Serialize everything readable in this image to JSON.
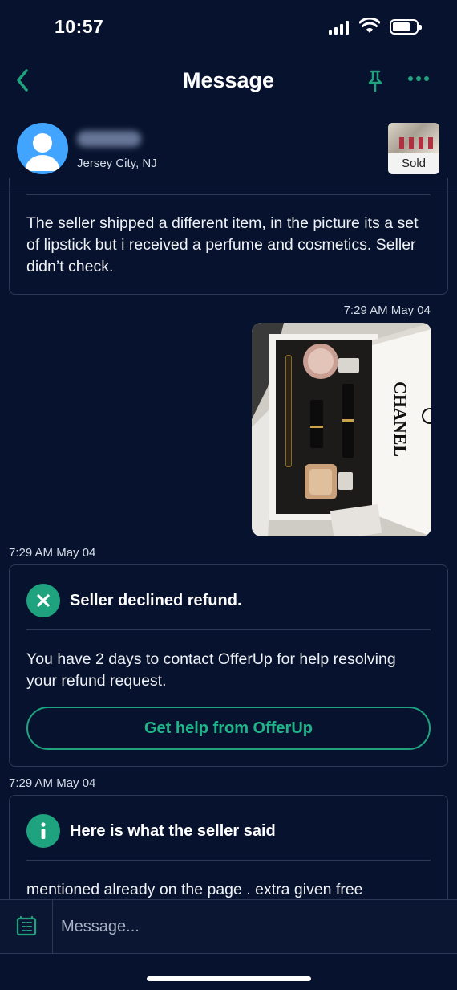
{
  "status_bar": {
    "time": "10:57"
  },
  "nav": {
    "title": "Message"
  },
  "seller": {
    "location": "Jersey City, NJ",
    "listing_badge": "Sold"
  },
  "messages": {
    "first_card_text": "The seller shipped a different item, in the picture its a set of lipstick but i received a perfume and cosmetics. Seller didn’t check.",
    "photo_timestamp": "7:29 AM May 04",
    "photo_box_brand": "CHANEL",
    "declined": {
      "timestamp": "7:29 AM May 04",
      "title": "Seller declined refund.",
      "body": "You have 2 days to contact OfferUp for help resolving your refund request.",
      "button_label": "Get help from OfferUp"
    },
    "seller_said": {
      "timestamp": "7:29 AM May 04",
      "title": "Here is what the seller said",
      "body": "mentioned already on the page . extra given free"
    }
  },
  "composer": {
    "placeholder": "Message..."
  },
  "colors": {
    "background": "#07132e",
    "accent": "#1fa37f",
    "border": "#2b3957"
  }
}
